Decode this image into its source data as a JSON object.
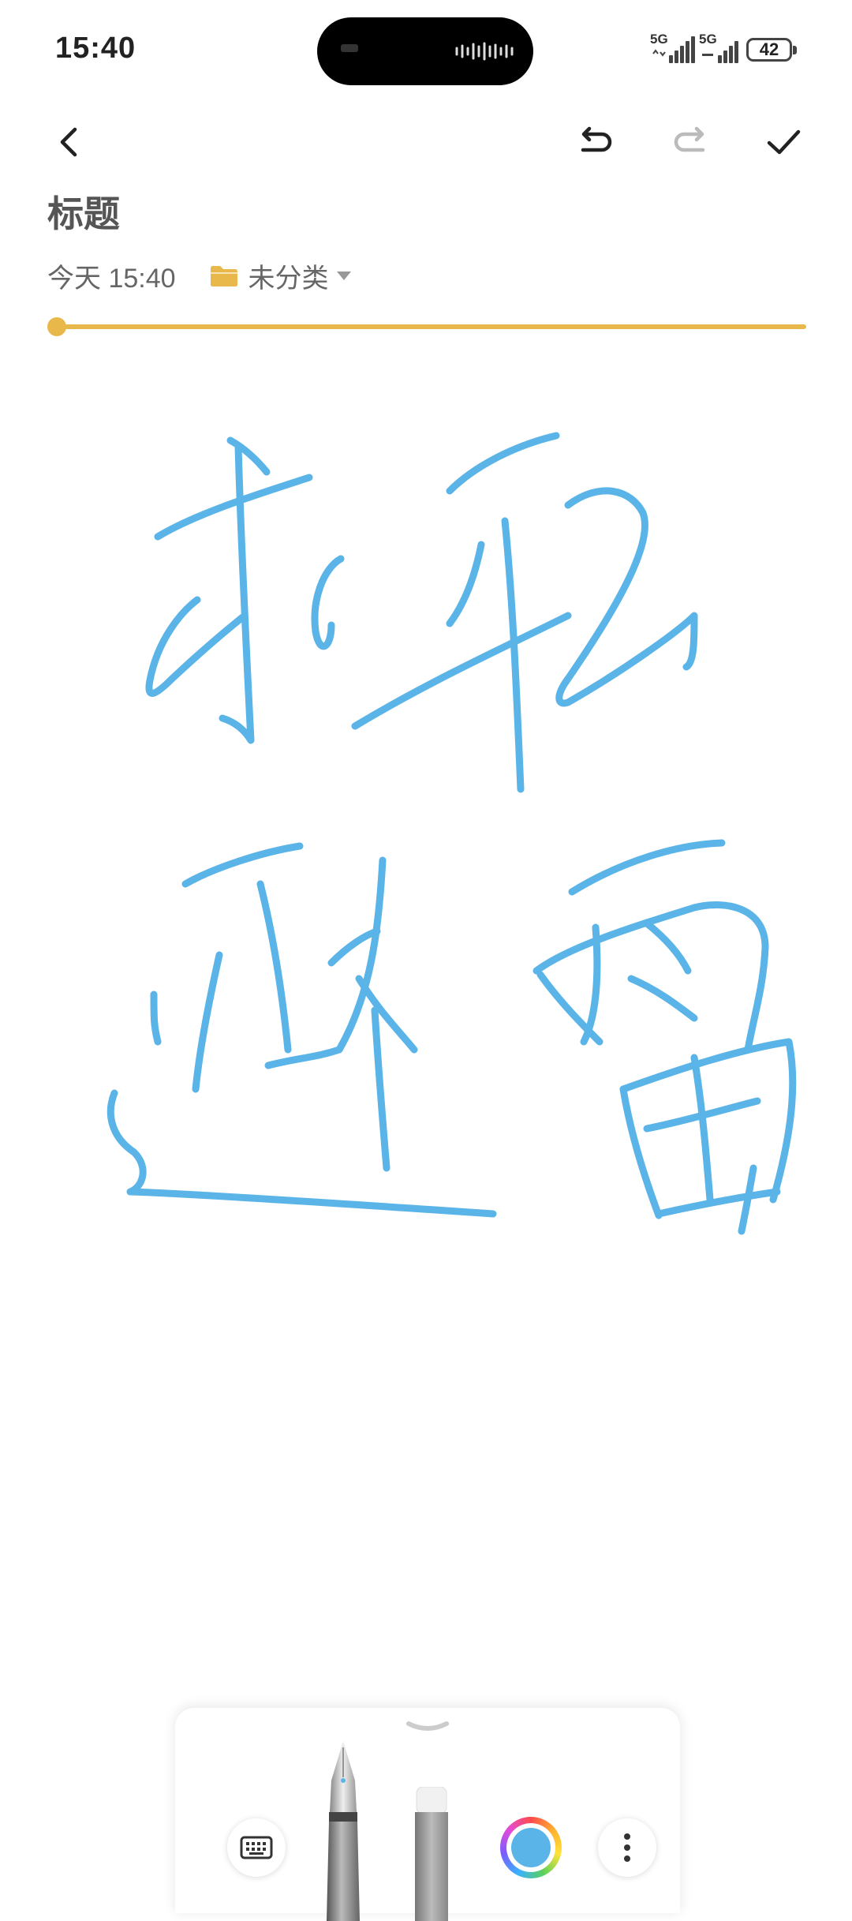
{
  "status_bar": {
    "time": "15:40",
    "signal_1": "5G",
    "signal_2": "5G",
    "battery": "42"
  },
  "toolbar": {
    "back_icon": "chevron-left-icon",
    "undo_icon": "undo-icon",
    "redo_icon": "redo-icon",
    "confirm_icon": "check-icon"
  },
  "note": {
    "title": "标题",
    "date": "今天 15:40",
    "folder": "未分类"
  },
  "handwriting": {
    "text": "求职避雷",
    "ink_color": "#5AB4E8"
  },
  "playback_progress": 0,
  "tool_panel": {
    "keyboard_icon": "keyboard-icon",
    "pen_tool": "fountain-pen-icon",
    "marker_tool": "marker-icon",
    "current_color": "#5AB4E8",
    "more_icon": "more-vertical-icon"
  },
  "colors": {
    "accent": "#E9B84A",
    "ink": "#5AB4E8"
  }
}
